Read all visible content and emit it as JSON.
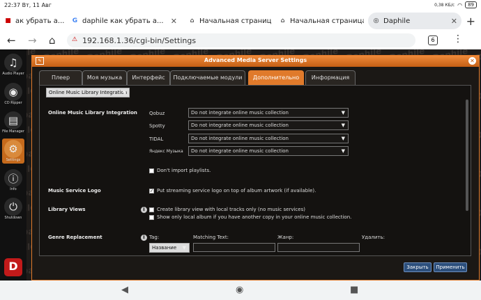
{
  "statusbar": {
    "time": "22:37",
    "date": "Вт, 11 Авг",
    "right": "0,38 КБ/с",
    "battery": "89"
  },
  "browser_tabs": [
    {
      "title": "ак убрать а...",
      "favicon": "red-box-icon"
    },
    {
      "title": "daphile как убрать а...",
      "favicon": "google-icon"
    },
    {
      "title": "Начальная страница",
      "favicon": "home-icon"
    },
    {
      "title": "Начальная страница",
      "favicon": "home-icon"
    },
    {
      "title": "Daphile",
      "favicon": "globe-icon"
    }
  ],
  "toolbar": {
    "url": "192.168.1.36/cgi-bin/Settings",
    "tab_count": "6"
  },
  "sidebar": {
    "items": [
      {
        "label": "Audio Player",
        "icon": "music-note-icon"
      },
      {
        "label": "CD Ripper",
        "icon": "disc-icon"
      },
      {
        "label": "File Manager",
        "icon": "folder-icon"
      },
      {
        "label": "Settings",
        "icon": "gear-icon"
      },
      {
        "label": "Info",
        "icon": "info-icon"
      },
      {
        "label": "Shutdown",
        "icon": "power-icon"
      }
    ],
    "logo": "D"
  },
  "watermark": "Daphile",
  "dialog": {
    "title": "Advanced Media Server Settings",
    "tabs": [
      "Плеер",
      "Моя музыка",
      "Интерфейс",
      "Подключаемые модули",
      "Дополнительно",
      "Информация"
    ],
    "active_tab": "Дополнительно",
    "section_select": "Online Music Library Integration",
    "omli_label": "Online Music Library Integration",
    "services": [
      {
        "name": "Qobuz",
        "value": "Do not integrate online music collection"
      },
      {
        "name": "Spotty",
        "value": "Do not integrate online music collection"
      },
      {
        "name": "TIDAL",
        "value": "Do not integrate online music collection"
      },
      {
        "name": "Яндекс Музыка",
        "value": "Do not integrate online music collection"
      }
    ],
    "dont_import": "Don't import playlists.",
    "logo_label": "Music Service Logo",
    "logo_option": "Put streaming service logo on top of album artwork (if available).",
    "library_label": "Library Views",
    "library_opt1": "Create library view with local tracks only (no music services)",
    "library_opt2": "Show only local album if you have another copy in your online music collection.",
    "genre_label": "Genre Replacement",
    "tag_label": "Tag:",
    "tag_value": "Название",
    "matching_label": "Matching Text:",
    "genre_field_label": "Жанр:",
    "delete_label": "Удалить:",
    "close_btn": "Закрыть",
    "apply_btn": "Применить"
  }
}
